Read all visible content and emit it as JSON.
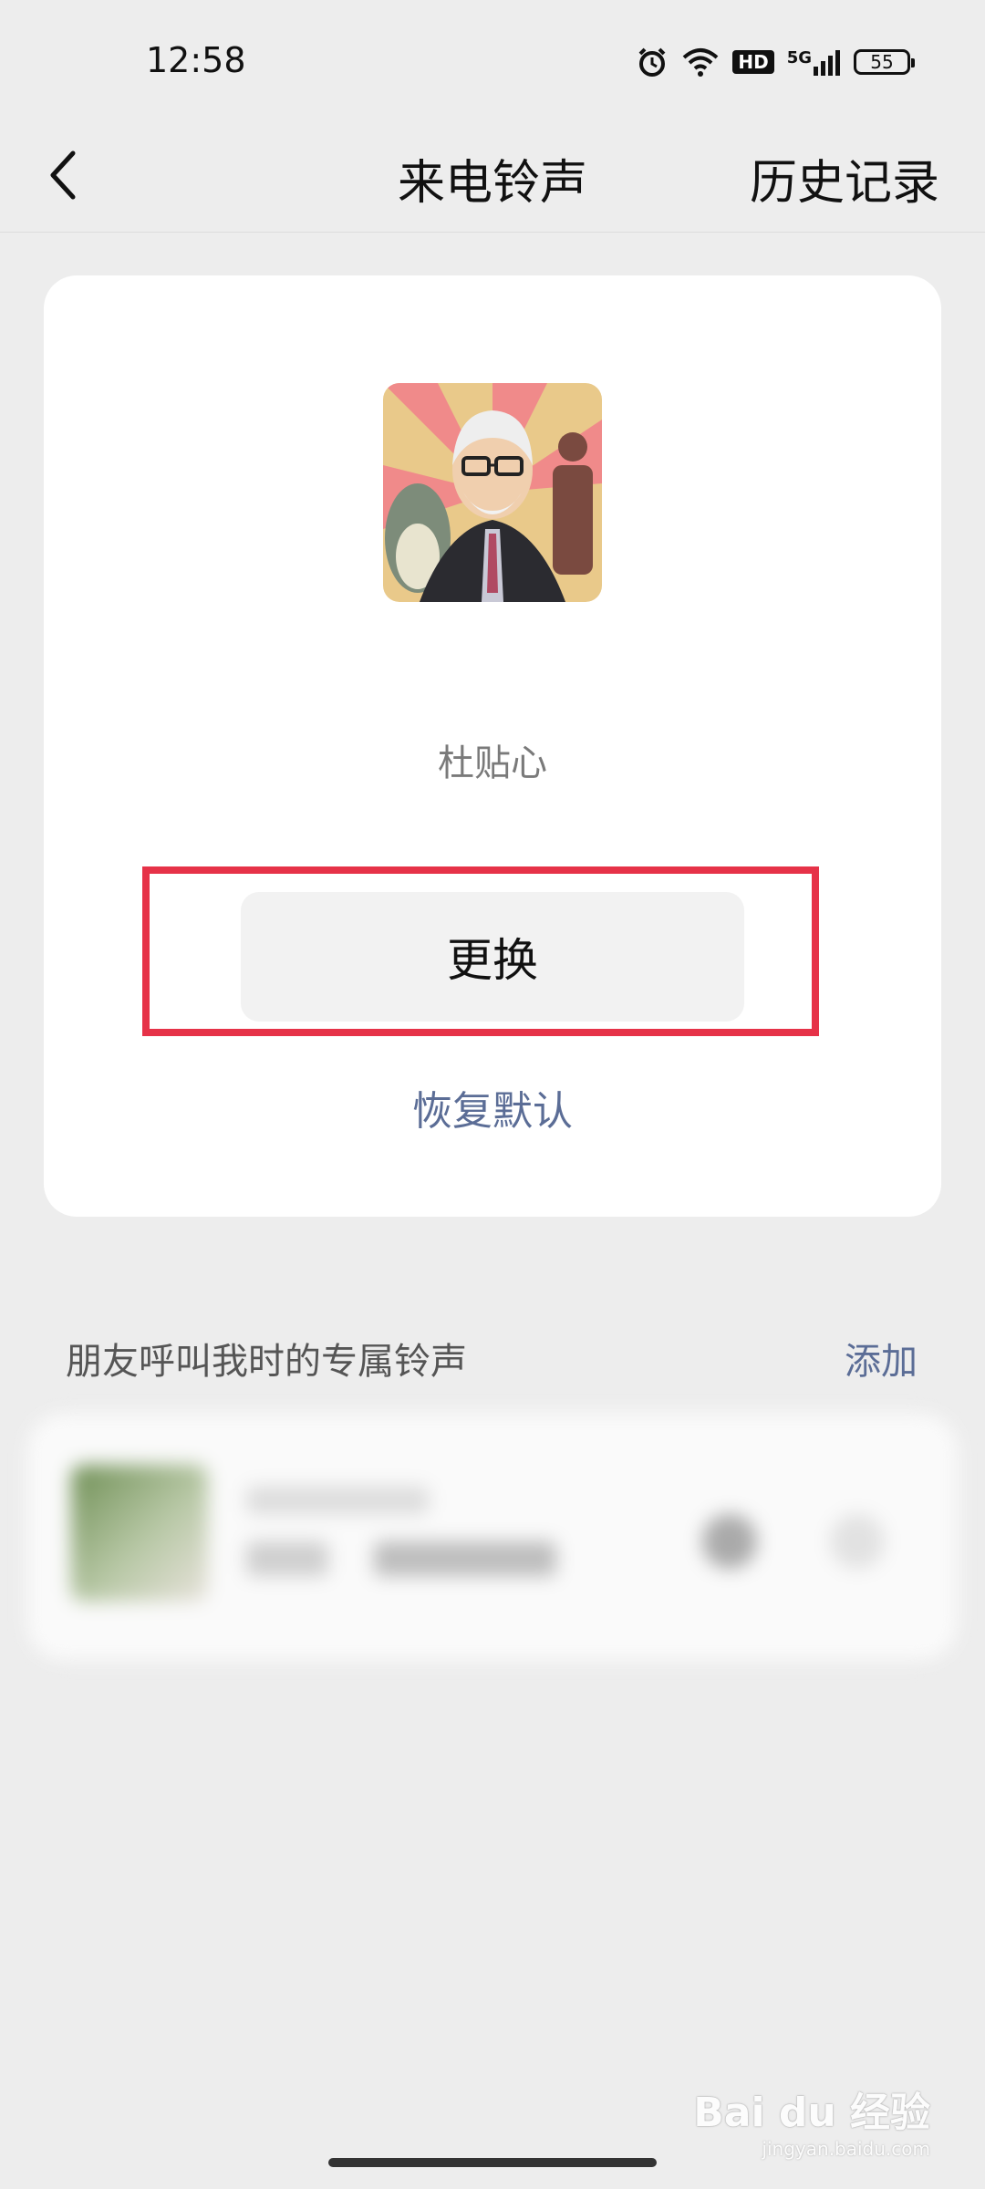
{
  "status_bar": {
    "time": "12:58",
    "icons": [
      "alarm-icon",
      "wifi-icon",
      "hd-icon",
      "5g-signal-icon",
      "battery-icon"
    ],
    "hd_label": "HD",
    "network_label": "5G",
    "battery_level": "55"
  },
  "header": {
    "back_icon": "chevron-left-icon",
    "title": "来电铃声",
    "history_label": "历史记录"
  },
  "ringtone_card": {
    "contact_name": "杜贴心",
    "change_label": "更换",
    "restore_label": "恢复默认",
    "highlight_color": "#e63248"
  },
  "friend_section": {
    "label": "朋友呼叫我时的专属铃声",
    "add_label": "添加"
  },
  "watermark": {
    "logo": "Bai du 经验",
    "url": "jingyan.baidu.com"
  },
  "colors": {
    "accent_link": "#5b6d96",
    "background": "#ededed",
    "card": "#ffffff"
  }
}
